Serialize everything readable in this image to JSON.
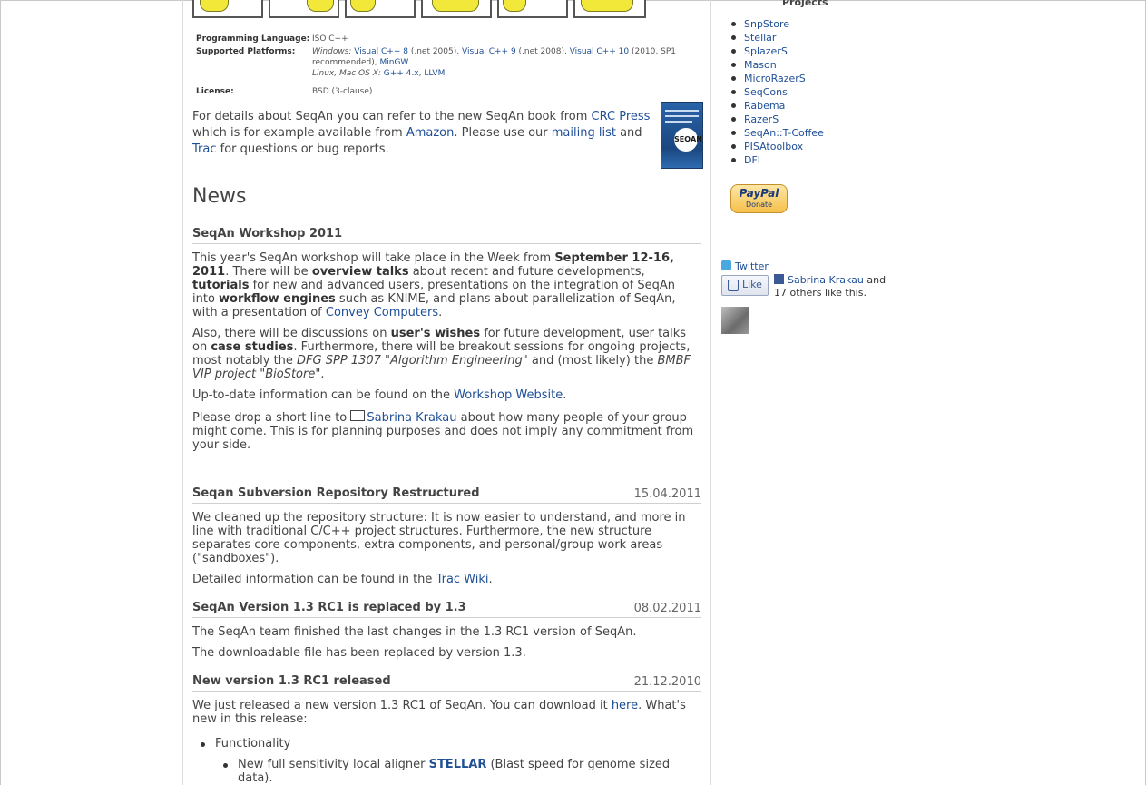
{
  "platforms": {
    "lang_label": "Programming Language:",
    "lang_value": "ISO C++",
    "supported_label": "Supported Platforms:",
    "windows_prefix": "Windows:",
    "vc8": "Visual C++ 8",
    "vc8_note": " (.net 2005), ",
    "vc9": "Visual C++ 9",
    "vc9_note": " (.net 2008), ",
    "vc10": "Visual C++ 10",
    "vc10_note": " (2010, SP1 recommended), ",
    "mingw": "MinGW",
    "linux_prefix": "Linux, Mac OS X:",
    "gpp": "G++ 4.x",
    "comma": ", ",
    "llvm": "LLVM",
    "license_label": "License:",
    "license_value": "BSD (3-clause)"
  },
  "intro": {
    "t1": "For details about SeqAn you can refer to the new SeqAn book from ",
    "crc": "CRC Press",
    "t2": " which is for example available from ",
    "amazon": "Amazon",
    "t3": ". Please use our ",
    "mailing": "mailing list",
    "t4": " and ",
    "trac": "Trac",
    "t5": " for questions or bug reports.",
    "book_logo": "SEQAN"
  },
  "news_heading": "News",
  "workshop": {
    "title": "SeqAn Workshop 2011",
    "p1a": "This year's SeqAn workshop will take place in the Week from ",
    "p1b": "September 12-16, 2011",
    "p1c": ". There will be ",
    "p1d": "overview talks",
    "p1e": " about recent and future developments, ",
    "p1f": "tutorials",
    "p1g": " for new and advanced users, presentations on the integration of SeqAn into ",
    "p1h": "workflow engines",
    "p1i": " such as KNIME, and plans about parallelization of SeqAn, with a presentation of ",
    "p1j": "Convey Computers",
    "p1k": ".",
    "p2a": "Also, there will be discussions on ",
    "p2b": "user's wishes",
    "p2c": " for future development, user talks on ",
    "p2d": "case studies",
    "p2e": ". Furthermore, there will be breakout sessions for ongoing projects, most notably the ",
    "p2f": "DFG SPP 1307 \"Algorithm Engineering\"",
    "p2g": " and (most likely) the ",
    "p2h": "BMBF VIP project \"BioStore\"",
    "p2i": ".",
    "p3a": "Up-to-date information can be found on the ",
    "p3b": "Workshop Website",
    "p3c": ".",
    "p4a": "Please drop a short line to ",
    "p4b": "Sabrina Krakau",
    "p4c": " about how many people of your group might come. This is for planning purposes and does not imply any commitment from your side."
  },
  "post_svn": {
    "title": "Seqan Subversion Repository Restructured",
    "date": "15.04.2011",
    "p1": "We cleaned up the repository structure: It is now easier to understand, and more in line with traditional C/C++ project structures. Furthermore, the new structure separates core components, extra components, and personal/group work areas (\"sandboxes\").",
    "p2a": "Detailed information can be found in the ",
    "p2b": "Trac Wiki",
    "p2c": "."
  },
  "post_13": {
    "title": "SeqAn Version 1.3 RC1 is replaced by 1.3",
    "date": "08.02.2011",
    "p1": "The SeqAn team finished the last changes in the 1.3 RC1 version of SeqAn.",
    "p2": "The downloadable file has been replaced by version 1.3."
  },
  "post_rc1": {
    "title": "New version 1.3 RC1 released",
    "date": "21.12.2010",
    "p1a": "We just released a new version 1.3 RC1 of SeqAn. You can download it ",
    "p1b": "here",
    "p1c": ". What's new in this release:",
    "b1": "Functionality",
    "b2a": "New full sensitivity local aligner ",
    "b2b": "STELLAR",
    "b2c": " (Blast speed for genome sized data)."
  },
  "sidebar": {
    "projects_heading": "Projects",
    "projects": [
      "SnpStore",
      "Stellar",
      "SplazerS",
      "Mason",
      "MicroRazerS",
      "SeqCons",
      "Rabema",
      "RazerS",
      "SeqAn::T-Coffee",
      "PISAtoolbox",
      "DFI"
    ],
    "paypal_logo": "PayPal",
    "paypal_donate": "Donate",
    "twitter": "Twitter",
    "like": "Like",
    "fb_name": "Sabrina Krakau",
    "fb_rest": " and 17 others like this."
  }
}
